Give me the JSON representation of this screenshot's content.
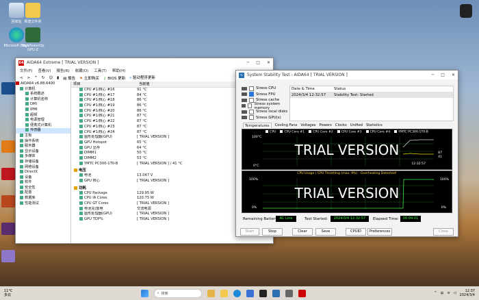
{
  "desktop": {
    "icons": [
      {
        "label": "回收站"
      },
      {
        "label": "新建文件夹"
      },
      {
        "label": "Microsoft Edge"
      },
      {
        "label": "TechPowerUp GPU-Z"
      }
    ]
  },
  "aida": {
    "title": "AIDA64 Extreme [ TRIAL VERSION ]",
    "menu": [
      "文件(F)",
      "查看(V)",
      "报告(R)",
      "收藏(O)",
      "工具(T)",
      "帮助(H)"
    ],
    "toolbar": [
      "报告",
      "立即购买",
      "BIOS 更新",
      "驱动程序更新"
    ],
    "tree_header": "AIDA64 v6.88.6400",
    "tree": [
      "计算机",
      "系统概述",
      "计算机名称",
      "DMI",
      "IPMI",
      "超频",
      "电源管理",
      "便携式计算机",
      "传感器",
      "主板",
      "操作系统",
      "服务器",
      "显示设备",
      "多媒体",
      "存储设备",
      "网络设备",
      "DirectX",
      "设备",
      "软件",
      "安全性",
      "配置",
      "数据库",
      "性能测试"
    ],
    "header": {
      "field": "项目",
      "value": "当前值"
    },
    "temps": [
      {
        "f": "CPU #1/核心 #16",
        "v": "91 °C"
      },
      {
        "f": "CPU #1/核心 #17",
        "v": "84 °C"
      },
      {
        "f": "CPU #1/核心 #18",
        "v": "86 °C"
      },
      {
        "f": "CPU #1/核心 #19",
        "v": "86 °C"
      },
      {
        "f": "CPU #1/核心 #20",
        "v": "86 °C"
      },
      {
        "f": "CPU #1/核心 #21",
        "v": "87 °C"
      },
      {
        "f": "CPU #1/核心 #22",
        "v": "87 °C"
      },
      {
        "f": "CPU #1/核心 #23",
        "v": "87 °C"
      },
      {
        "f": "CPU #1/核心 #24",
        "v": "87 °C"
      },
      {
        "f": "图形处理器(GPU)",
        "v": "[ TRIAL VERSION ]"
      },
      {
        "f": "GPU Hotspot",
        "v": "65 °C"
      },
      {
        "f": "GPU 显存",
        "v": "64 °C"
      },
      {
        "f": "DIMM1",
        "v": "50 °C"
      },
      {
        "f": "DIMM2",
        "v": "53 °C"
      },
      {
        "f": "YMTC PC300-1T0-B",
        "v": "[ TRIAL VERSION ] / 41 °C"
      }
    ],
    "voltage_title": "电压",
    "voltages": [
      {
        "f": "电池",
        "v": "13.047 V"
      },
      {
        "f": "GPU 核心",
        "v": "[ TRIAL VERSION ]"
      }
    ],
    "power_title": "功耗",
    "powers": [
      {
        "f": "CPU Package",
        "v": "129.95 W"
      },
      {
        "f": "CPU IA Cores",
        "v": "120.75 W"
      },
      {
        "f": "CPU GT Cores",
        "v": "[ TRIAL VERSION ]"
      },
      {
        "f": "电池充/放电",
        "v": "交流电源"
      },
      {
        "f": "图形处理器(GPU)",
        "v": "[ TRIAL VERSION ]"
      },
      {
        "f": "GPU TDP%",
        "v": "[ TRIAL VERSION ]"
      }
    ]
  },
  "sst": {
    "title": "System Stability Test - AIDA64 [ TRIAL VERSION ]",
    "stress": [
      {
        "label": "Stress CPU",
        "on": false
      },
      {
        "label": "Stress FPU",
        "on": true
      },
      {
        "label": "Stress cache",
        "on": false
      },
      {
        "label": "Stress system memory",
        "on": false
      },
      {
        "label": "Stress local disks",
        "on": false
      },
      {
        "label": "Stress GPU(s)",
        "on": false
      }
    ],
    "log_headers": {
      "date": "Date & Time",
      "status": "Status"
    },
    "log": {
      "date": "2024/3/4 12:32:57",
      "status": "Stability Test: Started"
    },
    "tabs": [
      "Temperatures",
      "Cooling Fans",
      "Voltages",
      "Powers",
      "Clocks",
      "Unified",
      "Statistics"
    ],
    "legend": [
      "CPU",
      "CPU Core #1",
      "CPU Core #2",
      "CPU Core #3",
      "CPU Core #4",
      "YMTC PC300-1T0-B"
    ],
    "graph1": {
      "top": "100°C",
      "bottom": "0°C",
      "time": "12:32:57",
      "r1": "87",
      "r2": "41",
      "trial": "TRIAL VERSION"
    },
    "graph2": {
      "title": "CPU Usage | CPU Throttling (max: 9%) - Overheating Detected!",
      "top": "100%",
      "bottom": "0%",
      "right_top": "100%",
      "right_bottom": "0%",
      "trial": "TRIAL VERSION"
    },
    "status": {
      "battery_label": "Remaining Battery:",
      "battery": "AC Line",
      "started_label": "Test Started:",
      "started": "2024/3/4 12:32:57",
      "elapsed_label": "Elapsed Time:",
      "elapsed": "00:04:01"
    },
    "buttons": [
      "Start",
      "Stop",
      "Clear",
      "Save",
      "CPUID",
      "Preferences",
      "Close"
    ]
  },
  "taskbar": {
    "weather_temp": "11°C",
    "weather_text": "多云",
    "search": "搜索",
    "time": "12:37",
    "date": "2024/3/4",
    "lang": "中"
  }
}
